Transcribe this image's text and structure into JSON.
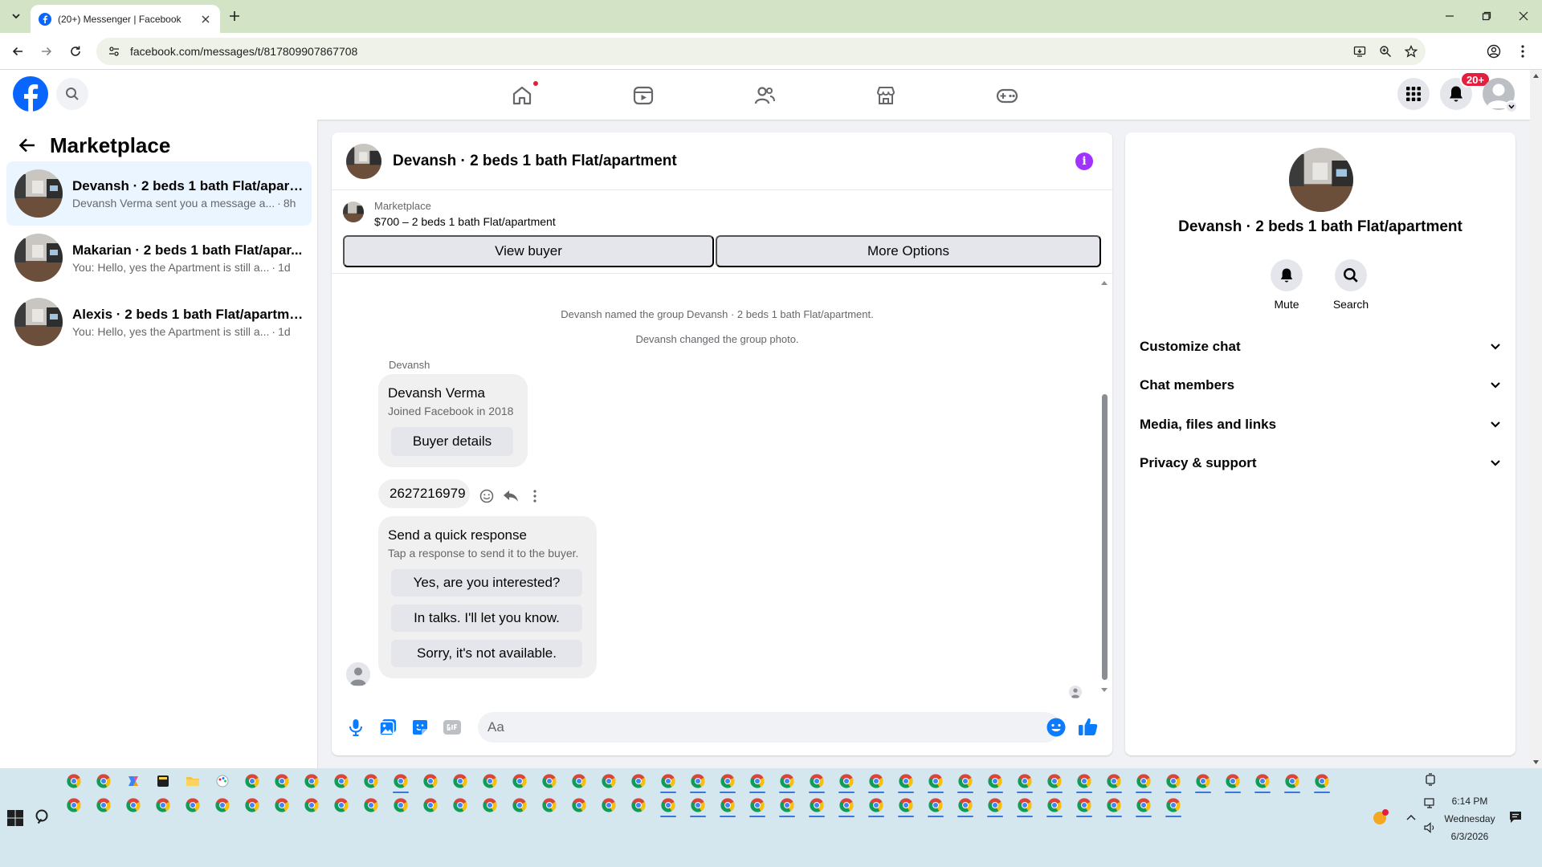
{
  "browser": {
    "tab_title": "(20+) Messenger | Facebook",
    "url": "facebook.com/messages/t/817809907867708"
  },
  "fb": {
    "notification_badge": "20+"
  },
  "left": {
    "title": "Marketplace",
    "conversations": [
      {
        "name": "Devansh · 2 beds 1 bath Flat/apart...",
        "preview": "Devansh Verma sent you a message a...",
        "sep": "·",
        "time": "8h"
      },
      {
        "name": "Makarian · 2 beds 1 bath Flat/apar...",
        "preview": "You: Hello, yes the Apartment is still a...",
        "sep": "·",
        "time": "1d"
      },
      {
        "name": "Alexis · 2 beds 1 bath Flat/apartme...",
        "preview": "You: Hello, yes the Apartment is still a...",
        "sep": "·",
        "time": "1d"
      }
    ]
  },
  "chat": {
    "title": "Devansh · 2 beds 1 bath Flat/apartment",
    "marketplace_label": "Marketplace",
    "listing": "$700 – 2 beds 1 bath Flat/apartment",
    "view_buyer": "View buyer",
    "more_options": "More Options",
    "system_messages": [
      "Devansh named the group Devansh · 2 beds 1 bath Flat/apartment.",
      "Devansh changed the group photo."
    ],
    "sender": "Devansh",
    "buyer_card": {
      "name": "Devansh Verma",
      "joined": "Joined Facebook in 2018",
      "button": "Buyer details"
    },
    "phone_message": "2627216979",
    "quick_response": {
      "title": "Send a quick response",
      "subtitle": "Tap a response to send it to the buyer.",
      "options": [
        "Yes, are you interested?",
        "In talks. I'll let you know.",
        "Sorry, it's not available."
      ]
    },
    "composer_placeholder": "Aa"
  },
  "right": {
    "name": "Devansh · 2 beds 1 bath Flat/apartment",
    "mute": "Mute",
    "search": "Search",
    "sections": [
      "Customize chat",
      "Chat members",
      "Media, files and links",
      "Privacy & support"
    ]
  },
  "taskbar": {
    "time": "6:14 PM",
    "day": "Wednesday",
    "date": "6/3/2026"
  },
  "colors": {
    "fb_blue": "#0866ff",
    "messenger_blue": "#0a7cff",
    "info_purple": "#a033ff",
    "badge_red": "#e41e3f",
    "chrome_frame": "#d3e3c5",
    "taskbar": "#d4e7ee"
  }
}
